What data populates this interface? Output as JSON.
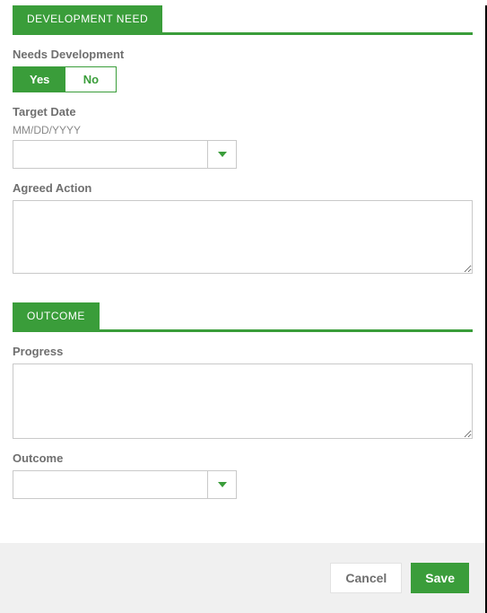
{
  "sections": {
    "development": {
      "tab_label": "DEVELOPMENT NEED",
      "needs_dev": {
        "label": "Needs Development",
        "yes": "Yes",
        "no": "No",
        "selected": "Yes"
      },
      "target_date": {
        "label": "Target Date",
        "hint": "MM/DD/YYYY",
        "value": ""
      },
      "agreed_action": {
        "label": "Agreed Action",
        "value": ""
      }
    },
    "outcome": {
      "tab_label": "OUTCOME",
      "progress": {
        "label": "Progress",
        "value": ""
      },
      "outcome_field": {
        "label": "Outcome",
        "value": ""
      }
    }
  },
  "footer": {
    "cancel": "Cancel",
    "save": "Save"
  }
}
